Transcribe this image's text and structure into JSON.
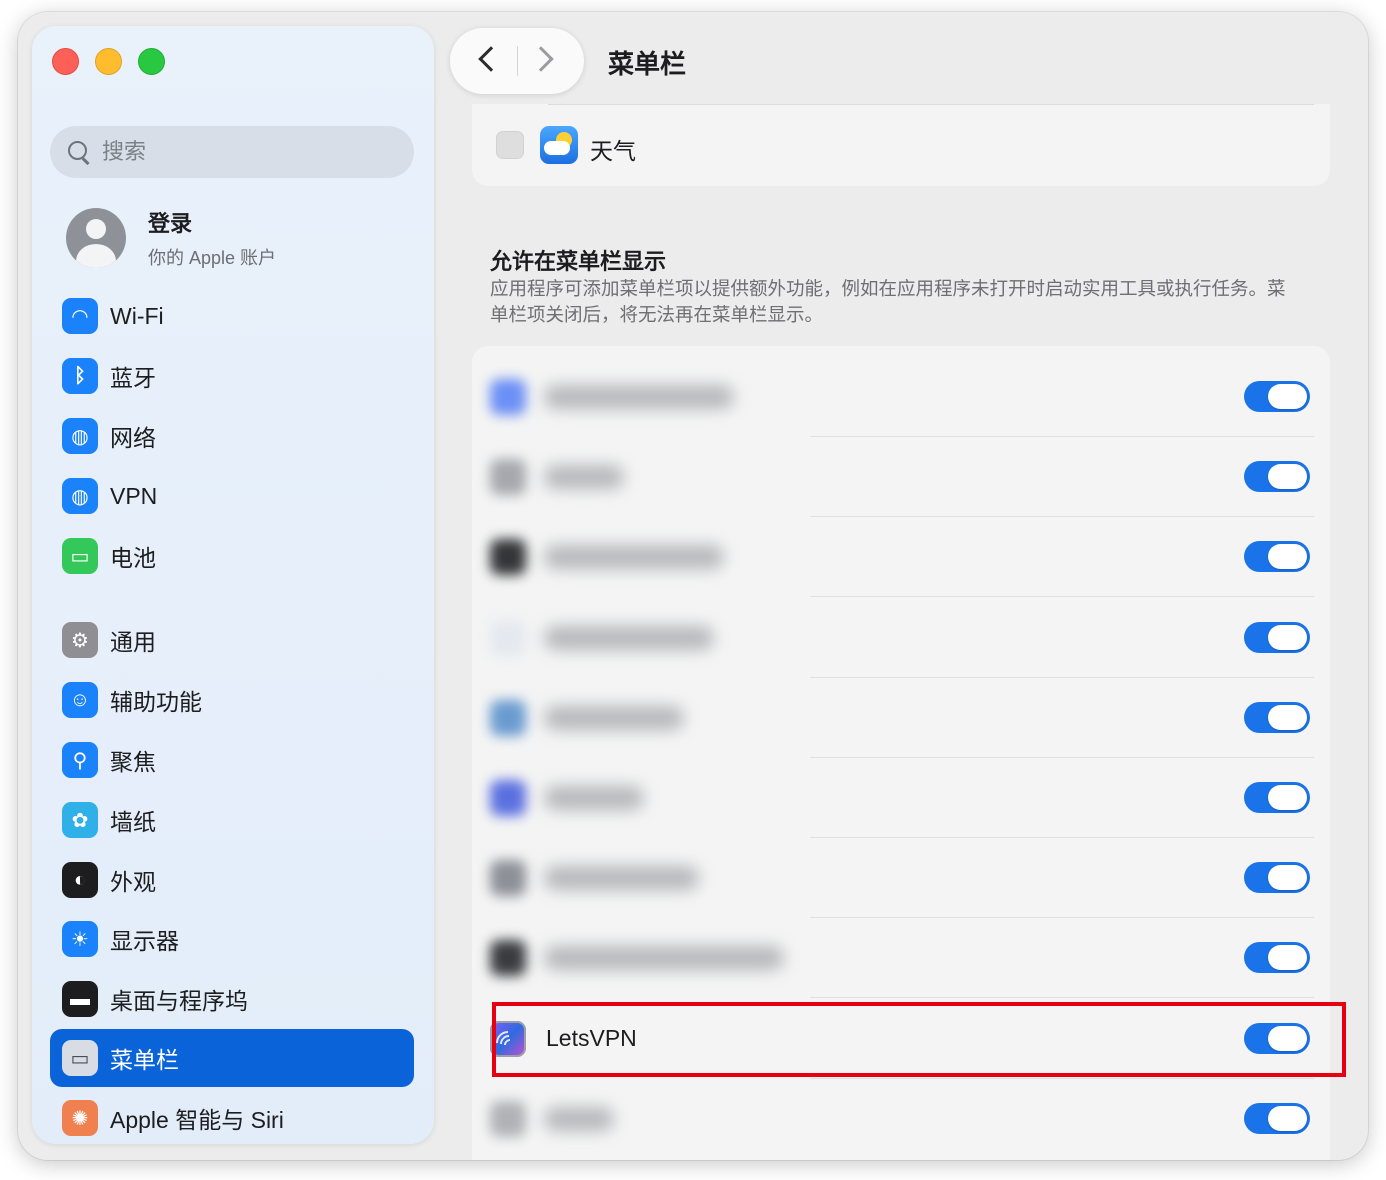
{
  "window": {
    "title": "菜单栏"
  },
  "sidebar": {
    "search_placeholder": "搜索",
    "account": {
      "name": "登录",
      "subtitle": "你的 Apple 账户"
    },
    "items": [
      {
        "label": "Wi-Fi",
        "icon": "wifi-icon",
        "color": "#1a82fb"
      },
      {
        "label": "蓝牙",
        "icon": "bluetooth-icon",
        "color": "#1a82fb"
      },
      {
        "label": "网络",
        "icon": "globe-icon",
        "color": "#1a82fb"
      },
      {
        "label": "VPN",
        "icon": "vpn-globe-icon",
        "color": "#1a82fb"
      },
      {
        "label": "电池",
        "icon": "battery-icon",
        "color": "#34c759"
      },
      {
        "label": "通用",
        "icon": "gear-icon",
        "color": "#8e8e93"
      },
      {
        "label": "辅助功能",
        "icon": "accessibility-icon",
        "color": "#1a82fb"
      },
      {
        "label": "聚焦",
        "icon": "spotlight-icon",
        "color": "#1a82fb"
      },
      {
        "label": "墙纸",
        "icon": "wallpaper-flower-icon",
        "color": "#30b0e8"
      },
      {
        "label": "外观",
        "icon": "appearance-icon",
        "color": "#1d1d1f"
      },
      {
        "label": "显示器",
        "icon": "display-sun-icon",
        "color": "#1a82fb"
      },
      {
        "label": "桌面与程序坞",
        "icon": "dock-icon",
        "color": "#1d1d1f"
      },
      {
        "label": "菜单栏",
        "icon": "menubar-icon",
        "color": "#d8dde5",
        "active": true
      },
      {
        "label": "Apple 智能与 Siri",
        "icon": "siri-icon",
        "color": "#f08050"
      }
    ]
  },
  "main": {
    "title": "菜单栏",
    "weather_row": {
      "label": "天气",
      "checked": false
    },
    "section": {
      "title": "允许在菜单栏显示",
      "description": "应用程序可添加菜单栏项以提供额外功能，例如在应用程序未打开时启动实用工具或执行任务。菜单栏项关闭后，将无法再在菜单栏显示。"
    },
    "rows": [
      {
        "label": "",
        "blurred": true,
        "icon_color": "#6b8ff5",
        "text_width": 190,
        "enabled": true
      },
      {
        "label": "",
        "blurred": true,
        "icon_color": "#a6a8ad",
        "text_width": 80,
        "enabled": true
      },
      {
        "label": "",
        "blurred": true,
        "icon_color": "#333538",
        "text_width": 180,
        "enabled": true
      },
      {
        "label": "",
        "blurred": true,
        "icon_color": "#e4e9ef",
        "text_width": 170,
        "enabled": true
      },
      {
        "label": "",
        "blurred": true,
        "icon_color": "#6a9bd0",
        "text_width": 140,
        "enabled": true
      },
      {
        "label": "",
        "blurred": true,
        "icon_color": "#5b70e0",
        "text_width": 100,
        "enabled": true
      },
      {
        "label": "",
        "blurred": true,
        "icon_color": "#8d9098",
        "text_width": 155,
        "enabled": true
      },
      {
        "label": "",
        "blurred": true,
        "icon_color": "#3a3c40",
        "text_width": 240,
        "enabled": true
      },
      {
        "label": "LetsVPN",
        "blurred": false,
        "enabled": true,
        "highlighted": true
      },
      {
        "label": "",
        "blurred": true,
        "icon_color": "#b0b2b6",
        "text_width": 70,
        "enabled": true
      }
    ]
  },
  "colors": {
    "accent": "#0a63d9",
    "toggle_on": "#1a73e8",
    "highlight": "#e60012"
  }
}
